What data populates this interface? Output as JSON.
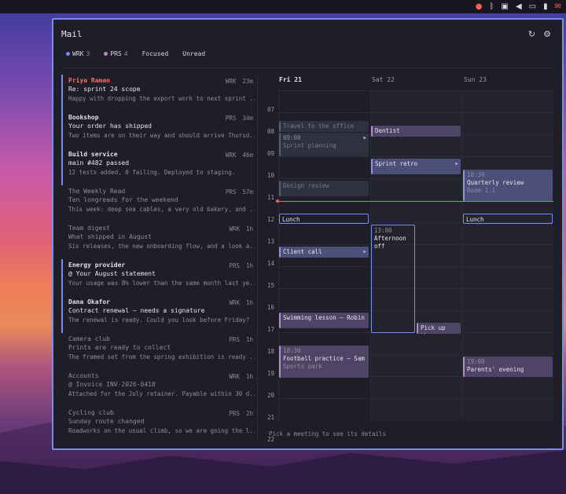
{
  "tray": {
    "icons": [
      "mascot-icon",
      "bluetooth-icon",
      "window-icon",
      "volume-icon",
      "display-icon",
      "battery-icon",
      "mail-icon"
    ]
  },
  "window": {
    "title": "Mail",
    "refresh_icon": "↻",
    "settings_icon": "⚙"
  },
  "filters": [
    {
      "label": "WRK",
      "count": "3",
      "dot": "#7a8ce8"
    },
    {
      "label": "PRS",
      "count": "4",
      "dot": "#b18ad0"
    },
    {
      "label": "Focused"
    },
    {
      "label": "Unread"
    }
  ],
  "mails": [
    {
      "from": "Priya Raman",
      "tag": "WRK",
      "age": "23m",
      "subject": "Re: sprint 24 scope",
      "preview": "Happy with dropping the export work to next sprint ..."
    },
    {
      "from": "Bookshop",
      "tag": "PRS",
      "age": "34m",
      "subject": "Your order has shipped",
      "preview": "Two items are on their way and should arrive Thursd..."
    },
    {
      "from": "Build service",
      "tag": "WRK",
      "age": "46m",
      "subject": "main #482 passed",
      "preview": "12 tests added, 0 failing. Deployed to staging."
    },
    {
      "from": "The Weekly Read",
      "tag": "PRS",
      "age": "57m",
      "subject": "Ten longreads for the weekend",
      "preview": "This week: deep sea cables, a very old bakery, and ..."
    },
    {
      "from": "Team digest",
      "tag": "WRK",
      "age": "1h",
      "subject": "What shipped in August",
      "preview": "Six releases, the new onboarding flow, and a look a..."
    },
    {
      "from": "Energy provider",
      "tag": "PRS",
      "age": "1h",
      "subject": "@  Your August statement",
      "preview": "Your usage was 8% lower than the same month last ye..."
    },
    {
      "from": "Dana Okafor",
      "tag": "WRK",
      "age": "1h",
      "subject": "Contract renewal — needs a signature",
      "preview": "The renewal is ready. Could you look before Friday?"
    },
    {
      "from": "Camera club",
      "tag": "PRS",
      "age": "1h",
      "subject": "Prints are ready to collect",
      "preview": "The framed set from the spring exhibition is ready ..."
    },
    {
      "from": "Accounts",
      "tag": "WRK",
      "age": "1h",
      "subject": "@  Invoice INV-2026-0418",
      "preview": "Attached for the July retainer. Payable within 30 d..."
    },
    {
      "from": "Cycling club",
      "tag": "PRS",
      "age": "2h",
      "subject": "Sunday route changed",
      "preview": "Roadworks on the usual climb, so we are going the l..."
    }
  ],
  "calendar": {
    "days": [
      "Fri 21",
      "Sat 22",
      "Sun 23"
    ],
    "hours": [
      "07",
      "08",
      "09",
      "10",
      "11",
      "12",
      "13",
      "14",
      "15",
      "16",
      "17",
      "18",
      "19",
      "20",
      "21",
      "22"
    ],
    "events": {
      "travel": {
        "title": "Travel to the office"
      },
      "sprint_planning": {
        "time": "09:00",
        "title": "Sprint planning"
      },
      "design_review": {
        "title": "Design review"
      },
      "lunch_fri": {
        "title": "Lunch"
      },
      "client_call": {
        "title": "Client call"
      },
      "swimming": {
        "title": "Swimming lesson — Robin"
      },
      "football": {
        "time": "18:30",
        "title": "Football practice — Sam",
        "sub": "Sports park"
      },
      "dentist": {
        "title": "Dentist"
      },
      "sprint_retro": {
        "title": "Sprint retro"
      },
      "afternoon_off": {
        "time": "13:00",
        "title": "Afternoon off"
      },
      "pickup": {
        "title": "Pick up th..."
      },
      "quarterly": {
        "time": "10:30",
        "title": "Quarterly review",
        "sub": "Room 1.1"
      },
      "lunch_sun": {
        "title": "Lunch"
      },
      "parents": {
        "time": "19:00",
        "title": "Parents' evening"
      }
    },
    "footer": "Pick a meeting to see its details"
  }
}
